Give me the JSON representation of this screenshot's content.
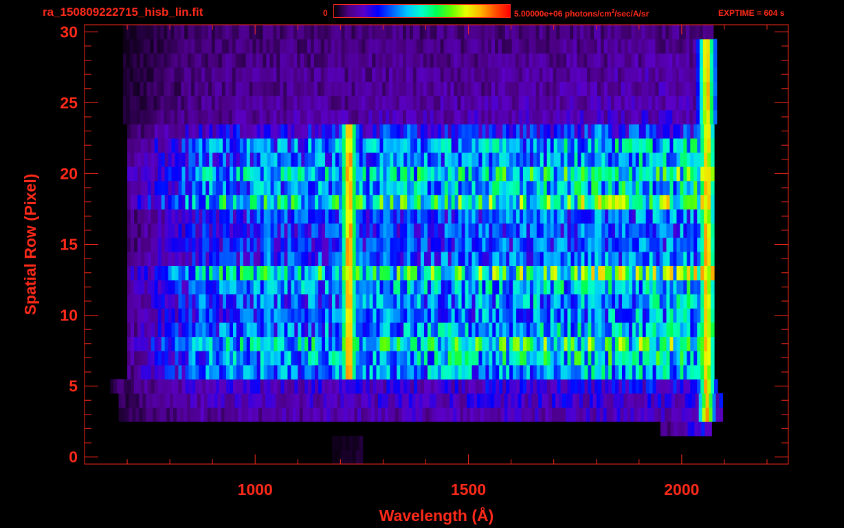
{
  "header": {
    "title": "ra_150809222715_hisb_lin.fit",
    "colorbar_min": "0",
    "colorbar_max_prefix": "5.00000e+06 photons/cm",
    "colorbar_max_sup": "2",
    "colorbar_max_suffix": "/sec/A/sr",
    "exptime": "EXPTIME = 604 s"
  },
  "colors": {
    "axis": "#ff2a1a",
    "background": "#000000",
    "colormap": [
      "#000000",
      "#4b0082",
      "#5a00c8",
      "#0000ff",
      "#0064ff",
      "#00c8ff",
      "#00ffc8",
      "#00ff50",
      "#64ff00",
      "#e6ff00",
      "#ffb400",
      "#ff5000",
      "#ff0000"
    ]
  },
  "chart_data": {
    "type": "heatmap",
    "title": "ra_150809222715_hisb_lin.fit",
    "xlabel": "Wavelength (Å)",
    "ylabel": "Spatial Row (Pixel)",
    "xlim": [
      600,
      2250
    ],
    "ylim": [
      -0.5,
      30.5
    ],
    "x_ticks": [
      1000,
      1500,
      2000
    ],
    "x_tick_labels": [
      "1000",
      "1500",
      "2000"
    ],
    "y_ticks": [
      0,
      5,
      10,
      15,
      20,
      25,
      30
    ],
    "y_tick_labels": [
      "0",
      "5",
      "10",
      "15",
      "20",
      "25",
      "30"
    ],
    "colorbar_range": [
      0,
      5000000
    ],
    "colorbar_units": "photons/cm^2/sec/A/sr",
    "exptime_s": 604,
    "colormap": "rainbow",
    "rows": [
      {
        "y": 0,
        "start": 1180,
        "end": 1250,
        "base": 0.05
      },
      {
        "y": 1,
        "start": 1180,
        "end": 1250,
        "base": 0.05
      },
      {
        "y": 2,
        "start": 1950,
        "end": 2070,
        "base": 0.3
      },
      {
        "y": 3,
        "start": 680,
        "end": 2090,
        "base": 0.15
      },
      {
        "y": 4,
        "start": 680,
        "end": 2090,
        "base": 0.18
      },
      {
        "y": 5,
        "start": 660,
        "end": 2080,
        "base": 0.2
      },
      {
        "y": 6,
        "start": 700,
        "end": 2075,
        "base": 0.4
      },
      {
        "y": 7,
        "start": 700,
        "end": 2075,
        "base": 0.45
      },
      {
        "y": 8,
        "start": 700,
        "end": 2075,
        "base": 0.52
      },
      {
        "y": 9,
        "start": 700,
        "end": 2075,
        "base": 0.4
      },
      {
        "y": 10,
        "start": 700,
        "end": 2075,
        "base": 0.36
      },
      {
        "y": 11,
        "start": 700,
        "end": 2075,
        "base": 0.38
      },
      {
        "y": 12,
        "start": 700,
        "end": 2075,
        "base": 0.42
      },
      {
        "y": 13,
        "start": 700,
        "end": 2075,
        "base": 0.55
      },
      {
        "y": 14,
        "start": 700,
        "end": 2075,
        "base": 0.32
      },
      {
        "y": 15,
        "start": 700,
        "end": 2075,
        "base": 0.3
      },
      {
        "y": 16,
        "start": 700,
        "end": 2075,
        "base": 0.3
      },
      {
        "y": 17,
        "start": 700,
        "end": 2075,
        "base": 0.32
      },
      {
        "y": 18,
        "start": 700,
        "end": 2075,
        "base": 0.55
      },
      {
        "y": 19,
        "start": 700,
        "end": 2075,
        "base": 0.42
      },
      {
        "y": 20,
        "start": 700,
        "end": 2075,
        "base": 0.48
      },
      {
        "y": 21,
        "start": 700,
        "end": 2075,
        "base": 0.38
      },
      {
        "y": 22,
        "start": 700,
        "end": 2075,
        "base": 0.4
      },
      {
        "y": 23,
        "start": 700,
        "end": 2075,
        "base": 0.25
      },
      {
        "y": 24,
        "start": 690,
        "end": 2080,
        "base": 0.15
      },
      {
        "y": 25,
        "start": 690,
        "end": 2080,
        "base": 0.13
      },
      {
        "y": 26,
        "start": 690,
        "end": 2080,
        "base": 0.12
      },
      {
        "y": 27,
        "start": 690,
        "end": 2080,
        "base": 0.12
      },
      {
        "y": 28,
        "start": 690,
        "end": 2080,
        "base": 0.11
      },
      {
        "y": 29,
        "start": 690,
        "end": 2080,
        "base": 0.1
      },
      {
        "y": 30,
        "start": 690,
        "end": 2070,
        "base": 0.09
      }
    ],
    "emission_lines": [
      {
        "wavelength": 1216,
        "peak": 1.0,
        "rows": [
          6,
          23
        ]
      },
      {
        "wavelength": 1025,
        "peak": 0.48,
        "rows": [
          7,
          22
        ]
      },
      {
        "wavelength": 1304,
        "peak": 0.45,
        "rows": [
          6,
          23
        ]
      },
      {
        "wavelength": 1356,
        "peak": 0.4,
        "rows": [
          6,
          23
        ]
      },
      {
        "wavelength": 1800,
        "peak": 0.52,
        "rows": [
          6,
          23
        ]
      },
      {
        "wavelength": 2055,
        "peak": 0.95,
        "rows": [
          3,
          29
        ]
      }
    ]
  }
}
